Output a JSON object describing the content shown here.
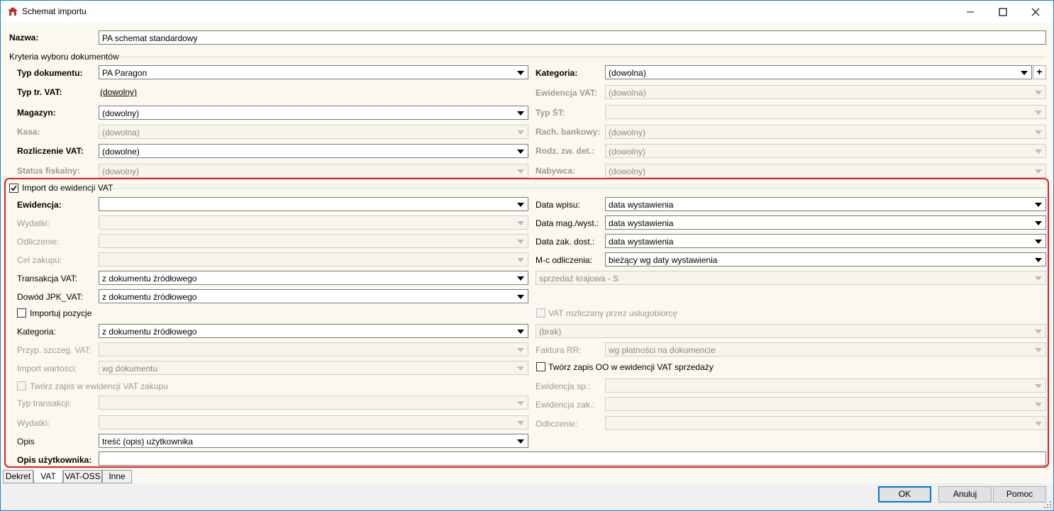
{
  "window": {
    "title": "Schemat importu"
  },
  "header": {
    "name_label": "Nazwa:",
    "name_value": "PA schemat standardowy",
    "criteria_group_label": "Kryteria wyboru dokumentów"
  },
  "criteria": {
    "typ_dokumentu": {
      "label": "Typ dokumentu:",
      "value": "PA Paragon"
    },
    "typ_tr_vat": {
      "label": "Typ tr. VAT:",
      "value": "(dowolny)"
    },
    "magazyn": {
      "label": "Magazyn:",
      "value": "(dowolny)"
    },
    "kasa": {
      "label": "Kasa:",
      "value": "(dowolna)"
    },
    "rozliczenie_vat": {
      "label": "Rozliczenie VAT:",
      "value": "(dowolne)"
    },
    "status_fiskalny": {
      "label": "Status fiskalny:",
      "value": "(dowolny)"
    },
    "kategoria": {
      "label": "Kategoria:",
      "value": "(dowolna)",
      "add_button": "+"
    },
    "ewidencja_vat": {
      "label": "Ewidencja VAT:",
      "value": "(dowolna)"
    },
    "typ_st": {
      "label": "Typ ŚT:",
      "value": ""
    },
    "rach_bankowy": {
      "label": "Rach. bankowy:",
      "value": "(dowolny)"
    },
    "rodz_zw_det": {
      "label": "Rodz. zw. det.:",
      "value": "(dowolny)"
    },
    "nabywca": {
      "label": "Nabywca:",
      "value": "(dowolny)"
    }
  },
  "vat_import": {
    "checkbox_label": "Import do ewidencji VAT",
    "checked": true,
    "ewidencja": {
      "label": "Ewidencja:",
      "value": ""
    },
    "wydatki": {
      "label": "Wydatki:",
      "value": ""
    },
    "odliczenie": {
      "label": "Odliczenie:",
      "value": ""
    },
    "cel_zakupu": {
      "label": "Cel zakupu:",
      "value": ""
    },
    "transakcja_vat": {
      "label": "Transakcja VAT:",
      "value": "z dokumentu źródłowego"
    },
    "dowod_jpk": {
      "label": "Dowód JPK_VAT:",
      "value": "z dokumentu źródłowego"
    },
    "importuj_pozycje": {
      "label": "Importuj pozycje",
      "checked": false
    },
    "kategoria": {
      "label": "Kategoria:",
      "value": "z dokumentu źródłowego"
    },
    "przyp_szczeg_vat": {
      "label": "Przyp. szczeg. VAT:",
      "value": ""
    },
    "import_wartosci": {
      "label": "Import wartości:",
      "value": "wg dokumentu"
    },
    "tworz_zapis_zakupu": {
      "label": "Twórz zapis w ewidencji VAT zakupu",
      "checked": false
    },
    "typ_transakcji": {
      "label": "Typ transakcji:",
      "value": ""
    },
    "wydatki2": {
      "label": "Wydatki:",
      "value": ""
    },
    "opis": {
      "label": "Opis",
      "value": "treść (opis) użytkownika"
    },
    "opis_uzytkownika": {
      "label": "Opis użytkownika:",
      "value": ""
    },
    "data_wpisu": {
      "label": "Data wpisu:",
      "value": "data wystawienia"
    },
    "data_mag_wyst": {
      "label": "Data mag./wyst.:",
      "value": "data wystawienia"
    },
    "data_zak_dost": {
      "label": "Data zak. dost.:",
      "value": "data wystawienia"
    },
    "mc_odliczenia": {
      "label": "M-c odliczenia:",
      "value": "bieżący wg daty wystawienia"
    },
    "sprzedaz": {
      "value": "sprzedaż krajowa - S"
    },
    "vat_uslugobiorca": {
      "label": "VAT rozliczany przez usługobiorcę",
      "checked": false
    },
    "brak": {
      "value": "(brak)"
    },
    "faktura_rr": {
      "label": "Faktura RR:",
      "value": "wg płatności na dokumencie"
    },
    "tworz_zapis_oo": {
      "label": "Twórz zapis OO w ewidencji VAT sprzedaży",
      "checked": false
    },
    "ewidencja_sp": {
      "label": "Ewidencja sp.:",
      "value": ""
    },
    "ewidencja_zak": {
      "label": "Ewidencja zak.:",
      "value": ""
    },
    "odliczenie2": {
      "label": "Odliczenie:",
      "value": ""
    }
  },
  "tabs": [
    {
      "label": "Dekret"
    },
    {
      "label": "VAT"
    },
    {
      "label": "VAT-OSS"
    },
    {
      "label": "Inne"
    }
  ],
  "buttons": {
    "ok": "OK",
    "anuluj": "Anuluj",
    "pomoc": "Pomoc"
  },
  "colors": {
    "form_background": "#fbf8ef",
    "highlight_border": "#e02020",
    "window_border": "#1883d7"
  }
}
